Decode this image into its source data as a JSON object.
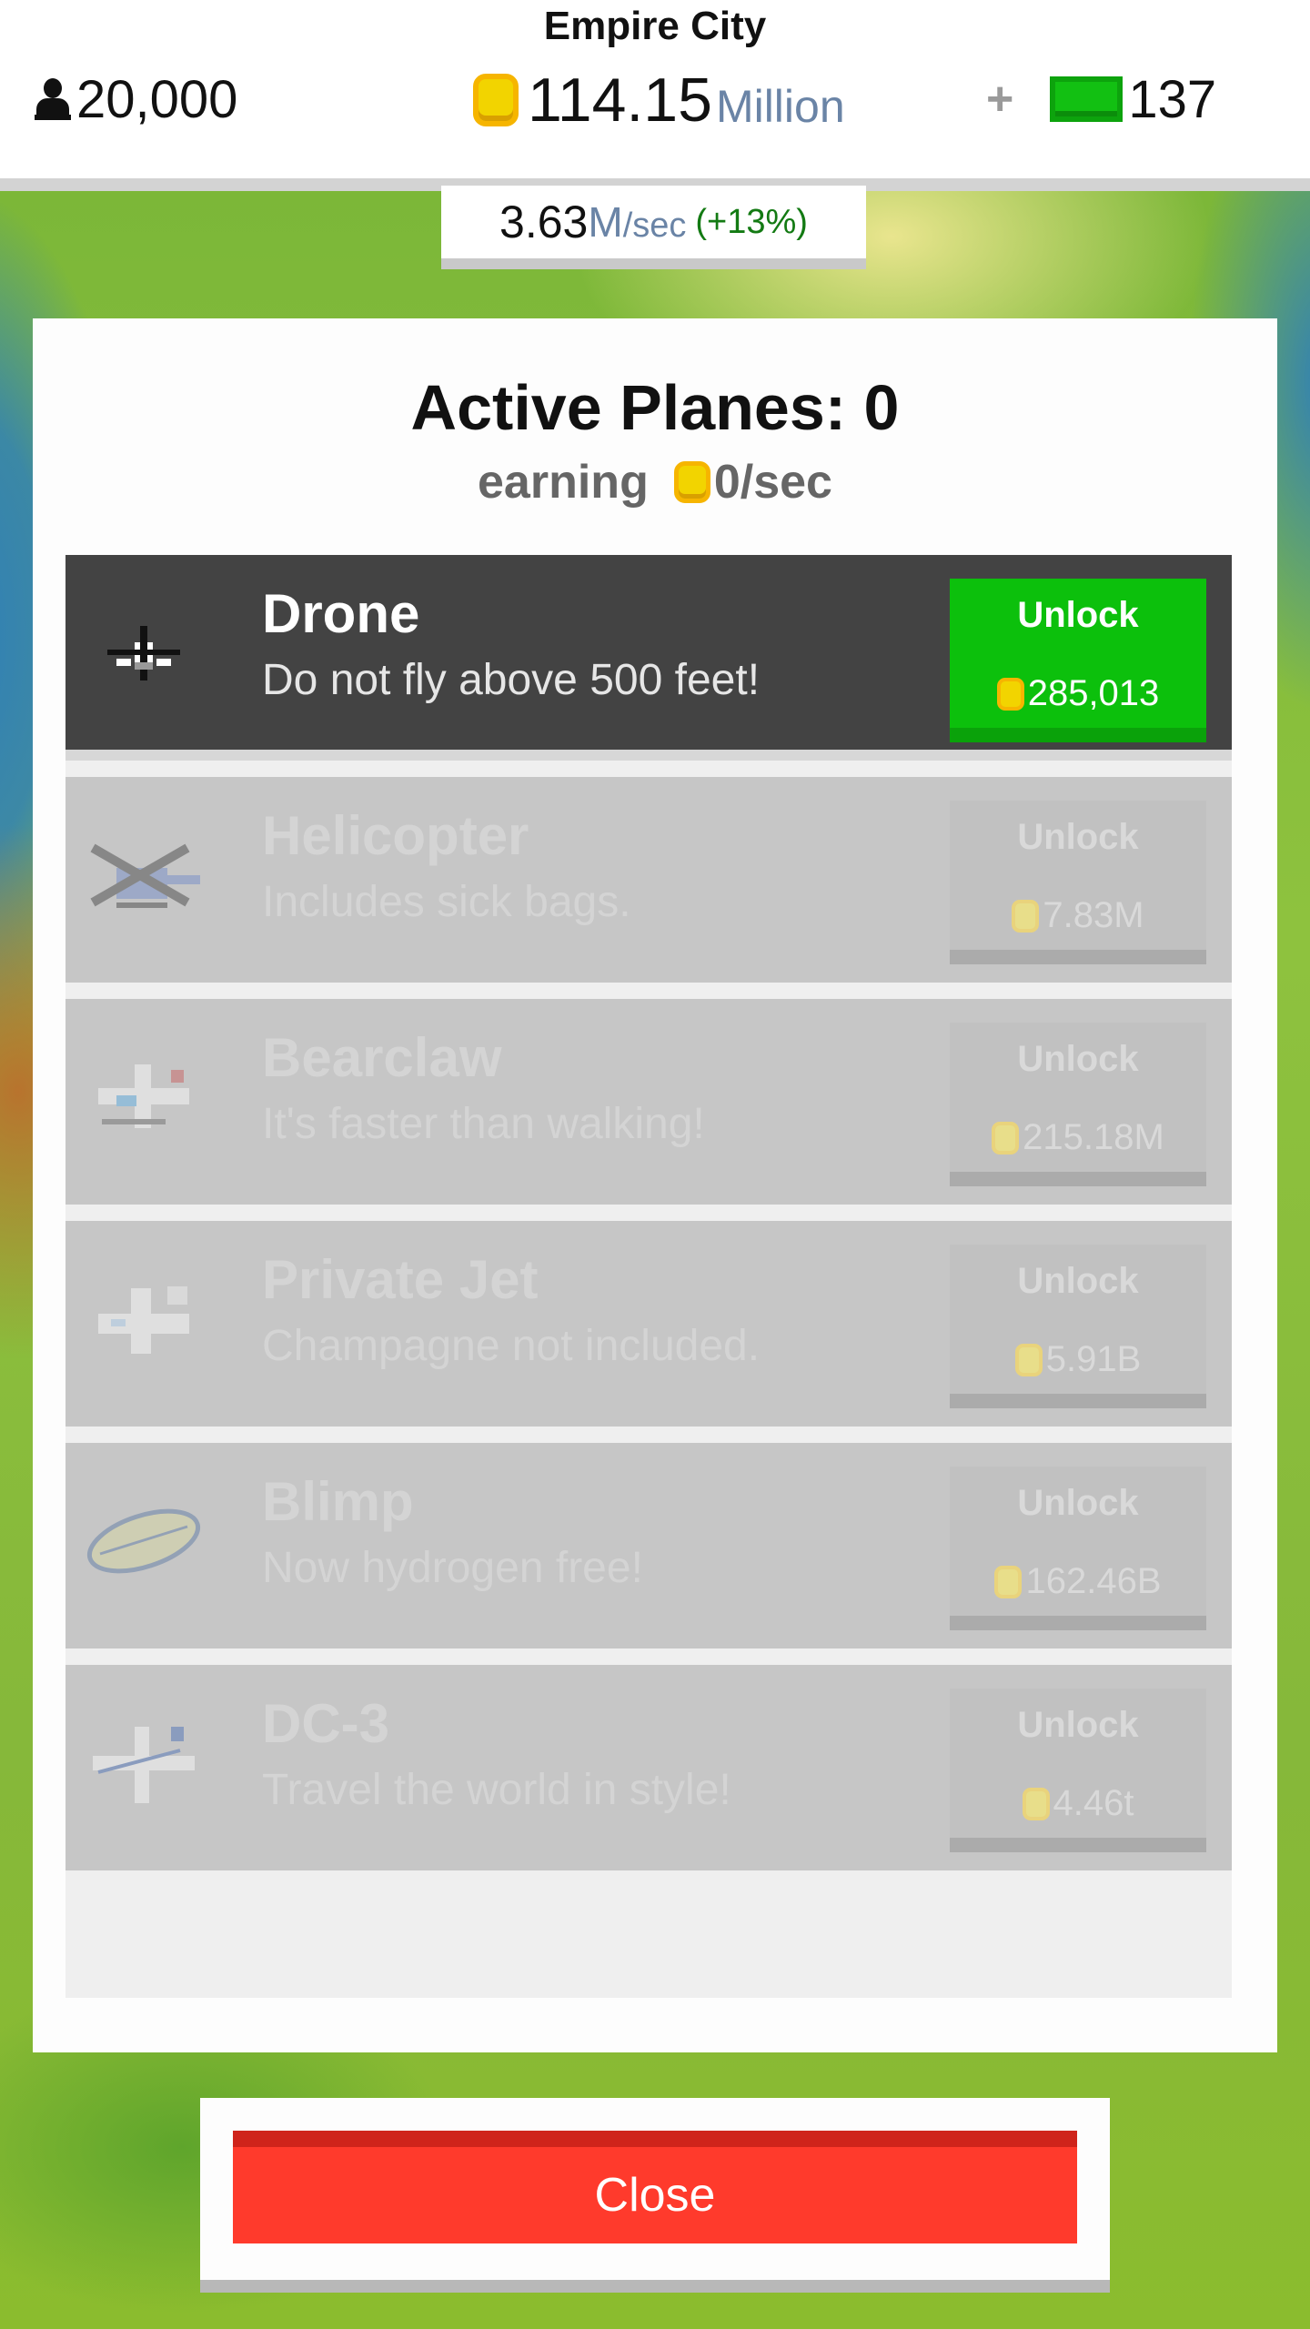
{
  "hud": {
    "city_name": "Empire City",
    "population": "20,000",
    "money_value": "114.15",
    "money_unit": "Million",
    "plus": "+",
    "cash_count": "137",
    "rate_value": "3.63",
    "rate_unit_m": "M",
    "rate_unit_sec": "/sec",
    "rate_change": "(+13%)"
  },
  "panel": {
    "title": "Active Planes: 0",
    "earning_label": "earning",
    "earning_rate": "0/sec",
    "unlock_label": "Unlock",
    "planes": [
      {
        "name": "Drone",
        "description": "Do not fly above 500 feet!",
        "price": "285,013",
        "state": "available",
        "icon": "drone-icon"
      },
      {
        "name": "Helicopter",
        "description": "Includes sick bags.",
        "price": "7.83M",
        "state": "locked",
        "icon": "helicopter-icon"
      },
      {
        "name": "Bearclaw",
        "description": "It's faster than walking!",
        "price": "215.18M",
        "state": "locked",
        "icon": "bearclaw-plane-icon"
      },
      {
        "name": "Private Jet",
        "description": "Champagne not included.",
        "price": "5.91B",
        "state": "locked",
        "icon": "private-jet-icon"
      },
      {
        "name": "Blimp",
        "description": "Now hydrogen free!",
        "price": "162.46B",
        "state": "locked",
        "icon": "blimp-icon"
      },
      {
        "name": "DC-3",
        "description": "Travel the world in style!",
        "price": "4.46t",
        "state": "locked",
        "icon": "dc3-plane-icon"
      }
    ]
  },
  "close_label": "Close",
  "colors": {
    "unlock_green": "#0cc00c",
    "close_red": "#ff3a2c",
    "coin_gold": "#f2d400",
    "cash_green": "#12c012"
  }
}
